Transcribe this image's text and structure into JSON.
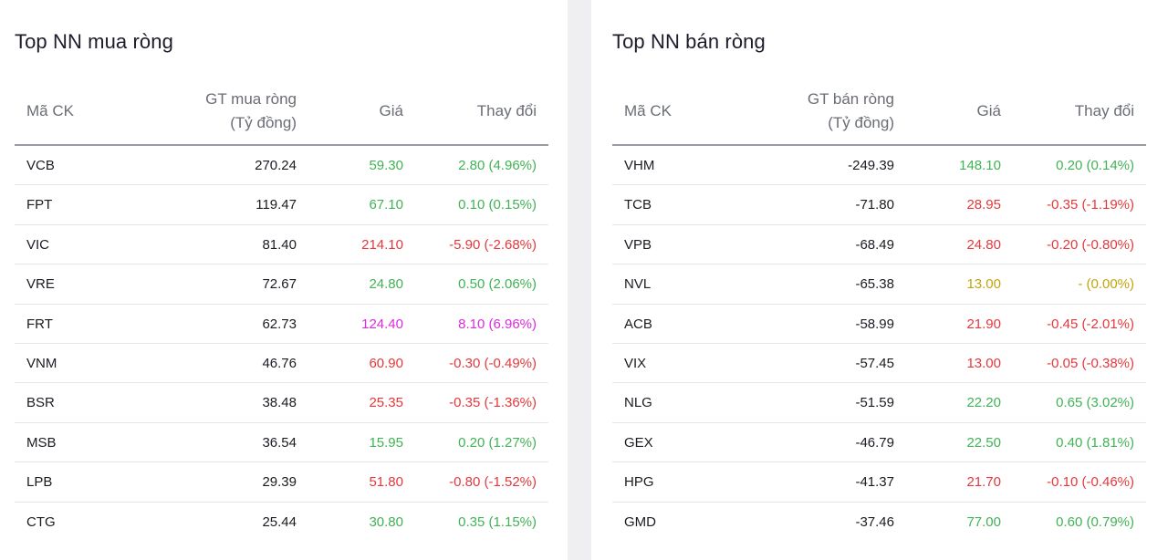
{
  "buy": {
    "title": "Top NN mua ròng",
    "headers": {
      "symbol": "Mã CK",
      "value_line1": "GT mua ròng",
      "value_line2": "(Tỷ đồng)",
      "price": "Giá",
      "change": "Thay đổi"
    },
    "rows": [
      {
        "symbol": "VCB",
        "value": "270.24",
        "price": "59.30",
        "change": "2.80 (4.96%)",
        "status": "up"
      },
      {
        "symbol": "FPT",
        "value": "119.47",
        "price": "67.10",
        "change": "0.10 (0.15%)",
        "status": "up"
      },
      {
        "symbol": "VIC",
        "value": "81.40",
        "price": "214.10",
        "change": "-5.90 (-2.68%)",
        "status": "down"
      },
      {
        "symbol": "VRE",
        "value": "72.67",
        "price": "24.80",
        "change": "0.50 (2.06%)",
        "status": "up"
      },
      {
        "symbol": "FRT",
        "value": "62.73",
        "price": "124.40",
        "change": "8.10 (6.96%)",
        "status": "ceil"
      },
      {
        "symbol": "VNM",
        "value": "46.76",
        "price": "60.90",
        "change": "-0.30 (-0.49%)",
        "status": "down"
      },
      {
        "symbol": "BSR",
        "value": "38.48",
        "price": "25.35",
        "change": "-0.35 (-1.36%)",
        "status": "down"
      },
      {
        "symbol": "MSB",
        "value": "36.54",
        "price": "15.95",
        "change": "0.20 (1.27%)",
        "status": "up"
      },
      {
        "symbol": "LPB",
        "value": "29.39",
        "price": "51.80",
        "change": "-0.80 (-1.52%)",
        "status": "down"
      },
      {
        "symbol": "CTG",
        "value": "25.44",
        "price": "30.80",
        "change": "0.35 (1.15%)",
        "status": "up"
      }
    ]
  },
  "sell": {
    "title": "Top NN bán ròng",
    "headers": {
      "symbol": "Mã CK",
      "value_line1": "GT bán ròng",
      "value_line2": "(Tỷ đồng)",
      "price": "Giá",
      "change": "Thay đổi"
    },
    "rows": [
      {
        "symbol": "VHM",
        "value": "-249.39",
        "price": "148.10",
        "change": "0.20 (0.14%)",
        "status": "up"
      },
      {
        "symbol": "TCB",
        "value": "-71.80",
        "price": "28.95",
        "change": "-0.35 (-1.19%)",
        "status": "down"
      },
      {
        "symbol": "VPB",
        "value": "-68.49",
        "price": "24.80",
        "change": "-0.20 (-0.80%)",
        "status": "down"
      },
      {
        "symbol": "NVL",
        "value": "-65.38",
        "price": "13.00",
        "change": "- (0.00%)",
        "status": "ref"
      },
      {
        "symbol": "ACB",
        "value": "-58.99",
        "price": "21.90",
        "change": "-0.45 (-2.01%)",
        "status": "down"
      },
      {
        "symbol": "VIX",
        "value": "-57.45",
        "price": "13.00",
        "change": "-0.05 (-0.38%)",
        "status": "down"
      },
      {
        "symbol": "NLG",
        "value": "-51.59",
        "price": "22.20",
        "change": "0.65 (3.02%)",
        "status": "up"
      },
      {
        "symbol": "GEX",
        "value": "-46.79",
        "price": "22.50",
        "change": "0.40 (1.81%)",
        "status": "up"
      },
      {
        "symbol": "HPG",
        "value": "-41.37",
        "price": "21.70",
        "change": "-0.10 (-0.46%)",
        "status": "down"
      },
      {
        "symbol": "GMD",
        "value": "-37.46",
        "price": "77.00",
        "change": "0.60 (0.79%)",
        "status": "up"
      }
    ]
  },
  "colors": {
    "up": "#41b255",
    "down": "#e5383b",
    "ceil": "#db2bde",
    "ref": "#c2a30e"
  }
}
